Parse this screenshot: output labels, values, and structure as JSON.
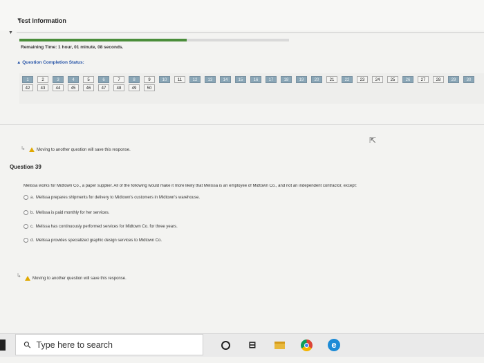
{
  "section": {
    "title": "Test Information"
  },
  "timer": {
    "label": "Remaining Time: 1 hour, 01 minute, 08 seconds.",
    "progress_fraction": 0.62
  },
  "status": {
    "toggle_label": "Question Completion Status:",
    "row1": [
      {
        "n": "1",
        "a": true
      },
      {
        "n": "2",
        "a": false
      },
      {
        "n": "3",
        "a": true
      },
      {
        "n": "4",
        "a": true
      },
      {
        "n": "5",
        "a": false
      },
      {
        "n": "6",
        "a": true
      },
      {
        "n": "7",
        "a": false
      },
      {
        "n": "8",
        "a": true
      },
      {
        "n": "9",
        "a": false
      },
      {
        "n": "10",
        "a": true
      },
      {
        "n": "11",
        "a": false
      },
      {
        "n": "12",
        "a": true
      },
      {
        "n": "13",
        "a": true
      },
      {
        "n": "14",
        "a": true
      },
      {
        "n": "15",
        "a": true
      },
      {
        "n": "16",
        "a": true
      },
      {
        "n": "17",
        "a": true
      },
      {
        "n": "18",
        "a": true
      },
      {
        "n": "19",
        "a": true
      },
      {
        "n": "20",
        "a": true
      },
      {
        "n": "21",
        "a": false
      },
      {
        "n": "22",
        "a": true
      },
      {
        "n": "23",
        "a": false
      },
      {
        "n": "24",
        "a": false
      },
      {
        "n": "25",
        "a": false
      },
      {
        "n": "26",
        "a": true
      },
      {
        "n": "27",
        "a": false
      },
      {
        "n": "28",
        "a": false
      },
      {
        "n": "29",
        "a": true
      },
      {
        "n": "30",
        "a": true
      }
    ],
    "row2": [
      {
        "n": "42",
        "a": false
      },
      {
        "n": "43",
        "a": false
      },
      {
        "n": "44",
        "a": false
      },
      {
        "n": "45",
        "a": false
      },
      {
        "n": "46",
        "a": false
      },
      {
        "n": "47",
        "a": false
      },
      {
        "n": "48",
        "a": false
      },
      {
        "n": "49",
        "a": false
      },
      {
        "n": "50",
        "a": false
      }
    ]
  },
  "warning_text": "Moving to another question will save this response.",
  "question": {
    "heading": "Question 39",
    "prompt": "Melissa works for Midtown Co., a paper supplier. All of the following would make it more likely that Melissa is an employee of Midtown Co., and not an independent contractor, except:",
    "options": [
      {
        "letter": "a.",
        "text": "Melissa prepares shipments for delivery to Midtown's customers in Midtown's warehouse."
      },
      {
        "letter": "b.",
        "text": "Melissa is paid monthly for her services."
      },
      {
        "letter": "c.",
        "text": "Melissa has continuously performed services for Midtown Co. for three years."
      },
      {
        "letter": "d.",
        "text": "Melissa provides specialized graphic design services to Midtown Co."
      }
    ]
  },
  "taskbar": {
    "search_placeholder": "Type here to search"
  },
  "colors": {
    "answered": "#8aa6b6",
    "progress": "#4a8d3a",
    "warning": "#e0a800",
    "edge": "#1d8bd6"
  }
}
